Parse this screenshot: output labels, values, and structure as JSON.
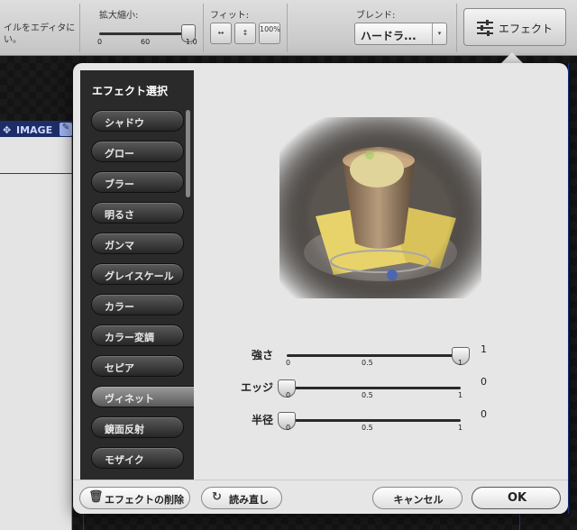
{
  "toolbar": {
    "hint_text": "イルをエディタに\nい。",
    "zoom_label": "拡大縮小:",
    "zoom_ticks": [
      "0",
      "60",
      "1.0"
    ],
    "fit_label": "フィット:",
    "fit_buttons": [
      "↔",
      "↕",
      "100%"
    ],
    "blend_label": "ブレンド:",
    "blend_value": "ハードラ...",
    "effect_button_label": "エフェクト"
  },
  "canvas": {
    "image_label": "IMAGE"
  },
  "effects_panel": {
    "title": "エフェクト選択",
    "items": [
      {
        "label": "シャドウ"
      },
      {
        "label": "グロー"
      },
      {
        "label": "ブラー"
      },
      {
        "label": "明るさ"
      },
      {
        "label": "ガンマ"
      },
      {
        "label": "グレイスケール"
      },
      {
        "label": "カラー"
      },
      {
        "label": "カラー変調"
      },
      {
        "label": "セピア"
      },
      {
        "label": "ヴィネット",
        "selected": true
      },
      {
        "label": "鏡面反射"
      },
      {
        "label": "モザイク"
      }
    ]
  },
  "sliders": [
    {
      "label": "強さ",
      "value": "1",
      "level": 1.0,
      "ticks": [
        "0",
        "0.5",
        "1"
      ]
    },
    {
      "label": "エッジ",
      "value": "0",
      "level": 0.0,
      "ticks": [
        "0",
        "0.5",
        "1"
      ]
    },
    {
      "label": "半径",
      "value": "0",
      "level": 0.0,
      "ticks": [
        "0",
        "0.5",
        "1"
      ]
    }
  ],
  "footer": {
    "delete_label": "エフェクトの削除",
    "reload_label": "読み直し",
    "cancel_label": "キャンセル",
    "ok_label": "OK"
  },
  "icons": {
    "effect": "sliders-icon",
    "delete": "trash-icon",
    "reload": "refresh-icon",
    "move": "move-icon",
    "edit": "pencil-icon"
  }
}
